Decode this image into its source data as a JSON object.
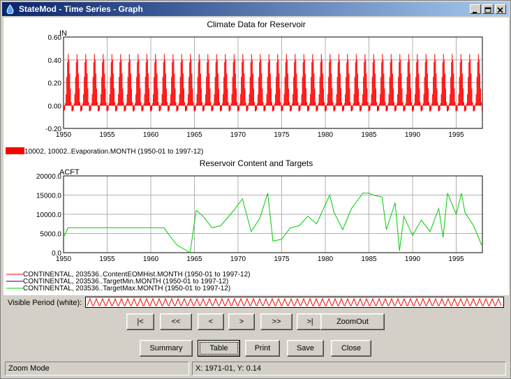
{
  "window": {
    "title": "StateMod - Time Series - Graph"
  },
  "chart_data": [
    {
      "type": "bar",
      "title": "Climate Data for Reservoir",
      "ylabel": "IN",
      "ylim": [
        -0.2,
        0.6
      ],
      "yticks": [
        "0.60",
        "0.40",
        "0.20",
        "0.00",
        "-0.20"
      ],
      "xlim": [
        1950,
        1998
      ],
      "xticks": [
        "1950",
        "1955",
        "1960",
        "1965",
        "1970",
        "1975",
        "1980",
        "1985",
        "1990",
        "1995"
      ],
      "series": [
        {
          "name": "10002, 10002..Evaporation.MONTH (1950-01 to 1997-12)",
          "color": "#ff0000",
          "annual_peak": 0.45,
          "annual_min": -0.05
        }
      ]
    },
    {
      "type": "line",
      "title": "Reservoir Content and Targets",
      "ylabel": "ACFT",
      "ylim": [
        0,
        20000
      ],
      "yticks": [
        "20000.0",
        "15000.0",
        "10000.0",
        "5000.0",
        "0.0"
      ],
      "xlim": [
        1950,
        1998
      ],
      "xticks": [
        "1950",
        "1955",
        "1960",
        "1965",
        "1970",
        "1975",
        "1980",
        "1985",
        "1990",
        "1995"
      ],
      "series": [
        {
          "name": "CONTINENTAL, 203536..ContentEOMHist.MONTH (1950-01 to 1997-12)",
          "color": "#ff0000"
        },
        {
          "name": "CONTINENTAL, 203536..TargetMin.MONTH (1950-01 to 1997-12)",
          "color": "#000080"
        },
        {
          "name": "CONTINENTAL, 203536..TargetMax.MONTH (1950-01 to 1997-12)",
          "color": "#00cc00",
          "x": [
            1950.0,
            1950.5,
            1951.5,
            1952.5,
            1953.5,
            1954.5,
            1955.5,
            1956.5,
            1957.5,
            1958.5,
            1959.5,
            1960.5,
            1961.5,
            1962.3,
            1963.0,
            1964.5,
            1965.2,
            1966.0,
            1967.0,
            1968.0,
            1969.5,
            1970.5,
            1971.5,
            1972.5,
            1973.4,
            1974.0,
            1975.0,
            1976.0,
            1977.0,
            1978.0,
            1979.0,
            1980.5,
            1981.0,
            1982.0,
            1983.0,
            1984.3,
            1985.0,
            1985.5,
            1986.5,
            1987.0,
            1988.0,
            1988.5,
            1989.0,
            1990.0,
            1991.0,
            1992.0,
            1993.0,
            1993.5,
            1994.0,
            1995.0,
            1995.6,
            1996.0,
            1997.0,
            1997.9
          ],
          "values": [
            4000,
            6500,
            6500,
            6500,
            6500,
            6500,
            6500,
            6500,
            6500,
            6500,
            6500,
            6500,
            6500,
            4000,
            2000,
            0,
            11000,
            9500,
            6500,
            7000,
            11000,
            14000,
            5500,
            9000,
            15500,
            3000,
            3500,
            6500,
            7000,
            9500,
            7500,
            15000,
            10500,
            6000,
            11500,
            15500,
            15500,
            15000,
            14500,
            6000,
            13000,
            500,
            9500,
            4500,
            8500,
            5500,
            11500,
            4000,
            15500,
            10000,
            15500,
            10500,
            7000,
            2000
          ]
        }
      ]
    }
  ],
  "visible_period_label": "Visible Period (white):",
  "nav_buttons": [
    "|<",
    "<<",
    "<",
    ">",
    ">>",
    ">|"
  ],
  "zoom_out_label": "ZoomOut",
  "action_buttons": {
    "summary": "Summary",
    "table": "Table",
    "print": "Print",
    "save": "Save",
    "close": "Close"
  },
  "status": {
    "mode": "Zoom Mode",
    "coords": "X:  1971-01,  Y:  0.14"
  }
}
